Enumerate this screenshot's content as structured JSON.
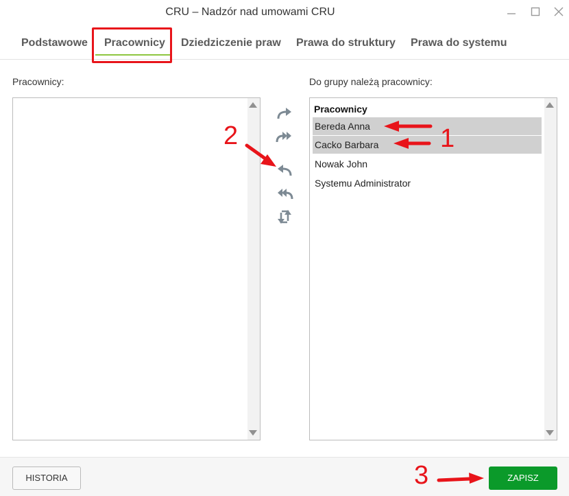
{
  "window": {
    "title": "CRU – Nadzór nad umowami CRU",
    "minimize_icon": "minimize-icon",
    "maximize_icon": "maximize-icon",
    "close_icon": "close-icon"
  },
  "tabs": [
    {
      "label": "Podstawowe"
    },
    {
      "label": "Pracownicy",
      "active": true
    },
    {
      "label": "Dziedziczenie praw"
    },
    {
      "label": "Prawa do struktury"
    },
    {
      "label": "Prawa do systemu"
    }
  ],
  "left_panel": {
    "label": "Pracownicy:"
  },
  "right_panel": {
    "label": "Do grupy należą pracownicy:",
    "header": "Pracownicy",
    "items": [
      {
        "name": "Bereda Anna",
        "selected": true
      },
      {
        "name": "Cacko Barbara",
        "selected": true
      },
      {
        "name": "Nowak John",
        "selected": false
      },
      {
        "name": "Systemu Administrator",
        "selected": false
      }
    ]
  },
  "controls": {
    "move_right": "arrow-right-icon",
    "move_all_right": "double-arrow-right-icon",
    "move_left": "arrow-left-icon",
    "move_all_left": "double-arrow-left-icon",
    "refresh": "refresh-icon"
  },
  "buttons": {
    "historia": "HISTORIA",
    "zapisz": "ZAPISZ"
  },
  "annotations": {
    "one": "1",
    "two": "2",
    "three": "3"
  },
  "colors": {
    "accent_red": "#e8141a",
    "tab_underline": "#8dc63f",
    "save_green": "#0b9a2a",
    "selected_row": "#d0d0d0"
  }
}
